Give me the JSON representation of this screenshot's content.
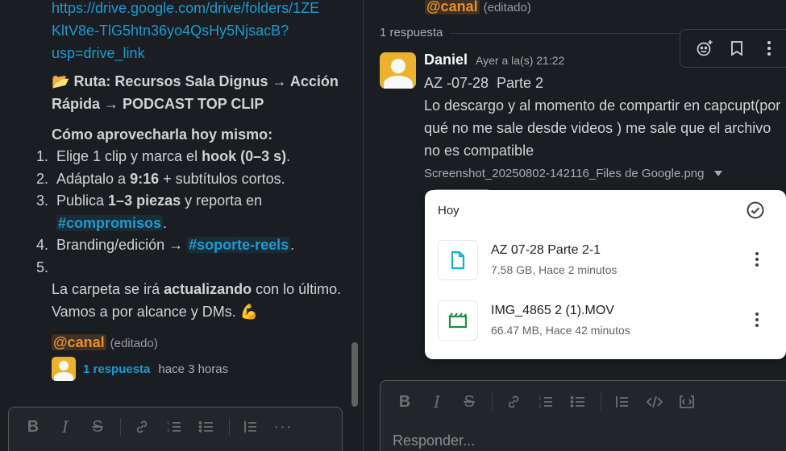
{
  "left": {
    "link_lines": [
      "https://drive.google.com/drive/folders/1ZE",
      "KltV8e-TlG5htn36yo4QsHy5NjsacB?",
      "usp=drive_link"
    ],
    "route_emoji": "📂",
    "route_line1": "Ruta: Recursos Sala Dignus → Acción",
    "route_line2": "Rápida → PODCAST TOP CLIP",
    "howto_title": "Cómo aprovecharla hoy mismo:",
    "steps": {
      "s1": {
        "num": "1.",
        "pre": "Elige 1 clip y marca el ",
        "bold": "hook (0–3 s)",
        "post": "."
      },
      "s2": {
        "num": "2.",
        "pre": "Adáptalo a ",
        "bold": "9:16",
        "post": " + subtítulos cortos."
      },
      "s3": {
        "num": "3.",
        "pre": "Publica ",
        "bold": "1–3 piezas",
        "post": " y reporta en",
        "chan": "#compromisos",
        "post2": "."
      },
      "s4": {
        "num": "4.",
        "pre": "Branding/edición → ",
        "chan": "#soporte-reels",
        "post": "."
      },
      "s5": {
        "num": "5."
      }
    },
    "closing_pre": "La carpeta se irá ",
    "closing_bold": "actualizando",
    "closing_post": " con lo último.",
    "closing_line2": "Vamos a por alcance y DMs. ",
    "closing_emoji": "💪",
    "mention": "@canal",
    "edited": "(editado)",
    "replies_link": "1 respuesta",
    "replies_time": "hace 3 horas"
  },
  "right": {
    "mention": "@canal",
    "edited": "(editado)",
    "replies_count": "1 respuesta",
    "author": "Daniel",
    "timestamp": "Ayer a la(s) 21:22",
    "msg_title": "AZ -07-28  Parte 2",
    "msg_body_lines": [
      "Lo descargo y al momento de compartir en capcupt(por",
      "qué no me sale desde videos ) me sale que el archivo",
      "no es compatible"
    ],
    "attachment_name": "Screenshot_20250802-142116_Files de Google.png",
    "popup": {
      "header": "Hoy",
      "files": [
        {
          "name": "AZ 07-28 Parte 2-1",
          "meta": "7.58 GB, Hace 2 minutos",
          "icon": "document-icon"
        },
        {
          "name": "IMG_4865 2 (1).MOV",
          "meta": "66.47 MB, Hace 42 minutos",
          "icon": "video-icon"
        }
      ]
    },
    "composer_placeholder": "Responder..."
  },
  "colors": {
    "link": "#1d9bd1",
    "mention": "#e8912d",
    "avatar": "#ecb22e",
    "doc_icon": "#12b5cb",
    "video_icon": "#1e8e3e"
  }
}
